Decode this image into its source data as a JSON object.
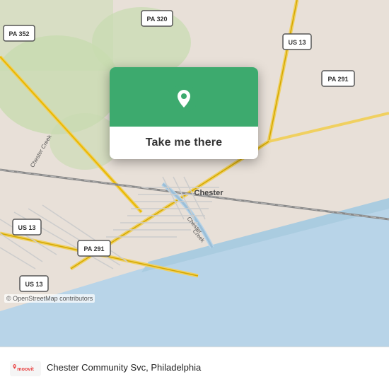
{
  "map": {
    "attribution": "© OpenStreetMap contributors",
    "background_color": "#e8e0d8"
  },
  "popup": {
    "button_label": "Take me there",
    "pin_icon": "location-pin"
  },
  "bottom_bar": {
    "place_name": "Chester Community Svc",
    "city": "Philadelphia",
    "full_text": "Chester Community Svc, Philadelphia",
    "logo_alt": "moovit"
  },
  "road_labels": {
    "pa352": "PA 352",
    "pa320": "PA 320",
    "us13_top": "US 13",
    "pa291_top": "PA 291",
    "pa291_bot": "PA 291",
    "us13_mid": "US 13",
    "us13_bot": "US 13",
    "chester_creek_label": "Chester Creek",
    "chester_label": "Chester"
  }
}
